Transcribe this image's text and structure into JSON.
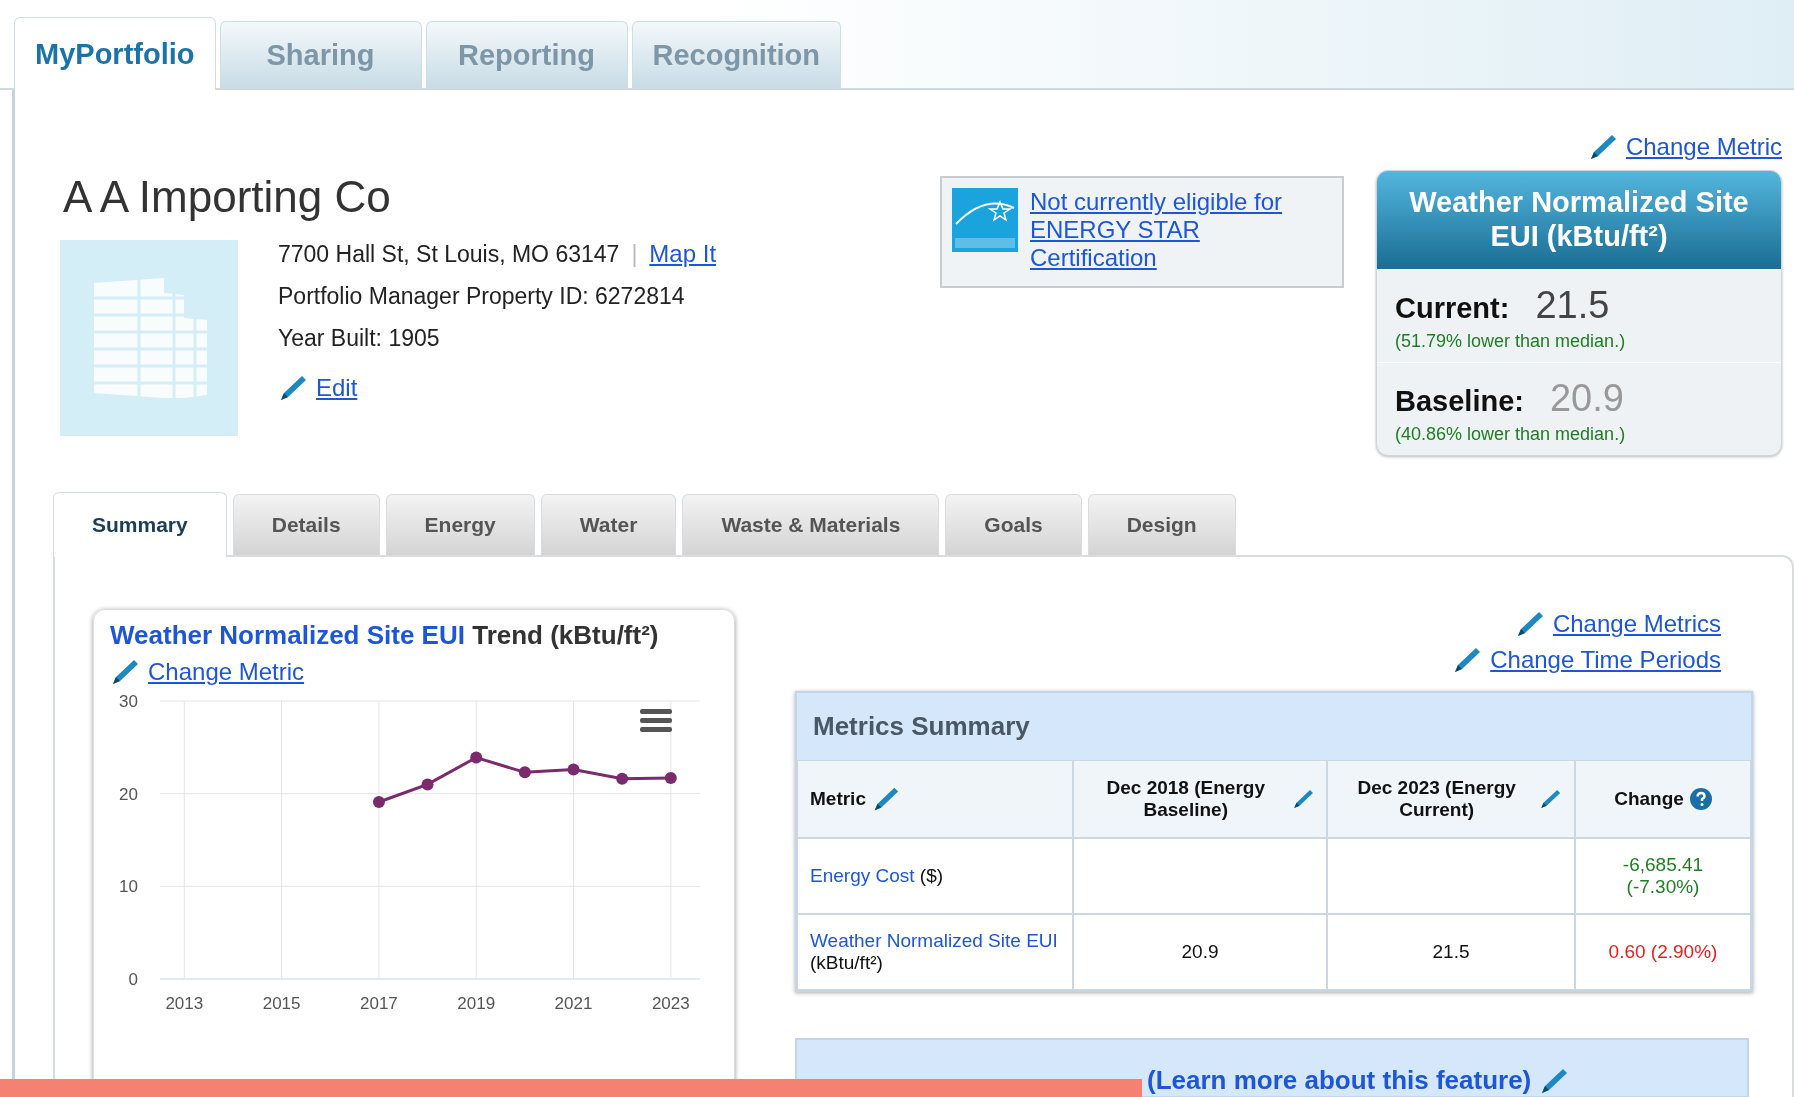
{
  "top_tabs": [
    {
      "label": "MyPortfolio",
      "selected": true
    },
    {
      "label": "Sharing",
      "selected": false
    },
    {
      "label": "Reporting",
      "selected": false
    },
    {
      "label": "Recognition",
      "selected": false
    }
  ],
  "property": {
    "name": "A A Importing Co",
    "address": "7700 Hall St, St Louis, MO 63147",
    "separator": "|",
    "map_link": "Map It",
    "property_id": "Portfolio Manager Property ID: 6272814",
    "year_built": "Year Built: 1905",
    "edit_link": "Edit"
  },
  "energy_star": {
    "message": "Not currently eligible for ENERGY STAR Certification"
  },
  "metric_card": {
    "change_link": "Change Metric",
    "title": "Weather Normalized Site EUI (kBtu/ft²)",
    "current_label": "Current:",
    "current_value": "21.5",
    "current_note": "(51.79% lower than median.)",
    "baseline_label": "Baseline:",
    "baseline_value": "20.9",
    "baseline_note": "(40.86% lower than median.)"
  },
  "section_tabs": [
    {
      "label": "Summary",
      "selected": true
    },
    {
      "label": "Details",
      "selected": false
    },
    {
      "label": "Energy",
      "selected": false
    },
    {
      "label": "Water",
      "selected": false
    },
    {
      "label": "Waste & Materials",
      "selected": false
    },
    {
      "label": "Goals",
      "selected": false
    },
    {
      "label": "Design",
      "selected": false
    }
  ],
  "trend": {
    "title_metric": "Weather Normalized Site EUI",
    "title_rest": "Trend (kBtu/ft²)",
    "change_link": "Change Metric",
    "chart_data": {
      "type": "line",
      "x": [
        2017,
        2018,
        2019,
        2020,
        2021,
        2022,
        2023
      ],
      "xlim": [
        2012.5,
        2023.6
      ],
      "ylim": [
        0,
        30
      ],
      "xticks": [
        2013,
        2015,
        2017,
        2019,
        2021,
        2023
      ],
      "yticks": [
        0,
        10,
        20,
        30
      ],
      "grid": true,
      "series": [
        {
          "color": "#7b2a6e",
          "marker": true,
          "values": [
            19.1,
            21.0,
            23.9,
            22.3,
            22.6,
            21.6,
            21.7
          ]
        }
      ]
    }
  },
  "links": [
    "Change Metrics",
    "Change Time Periods"
  ],
  "metrics_summary": {
    "title": "Metrics Summary",
    "columns": [
      {
        "label": "Metric",
        "kind": "edit"
      },
      {
        "label": "Dec 2018 (Energy Baseline)",
        "kind": "edit"
      },
      {
        "label": "Dec 2023 (Energy Current)",
        "kind": "edit"
      },
      {
        "label": "Change",
        "kind": "help"
      }
    ],
    "rows": [
      {
        "metric": "Energy Cost",
        "unit": "($)",
        "baseline": "",
        "current": "",
        "change": "-6,685.41 (-7.30%)",
        "color": "#1d7f22"
      },
      {
        "metric": "Weather Normalized Site EUI",
        "unit": "(kBtu/ft²)",
        "baseline": "20.9",
        "current": "21.5",
        "change": "0.60 (2.90%)",
        "color": "#f01b1b"
      }
    ]
  },
  "next_panel": {
    "title": "(Learn more about this feature)"
  }
}
